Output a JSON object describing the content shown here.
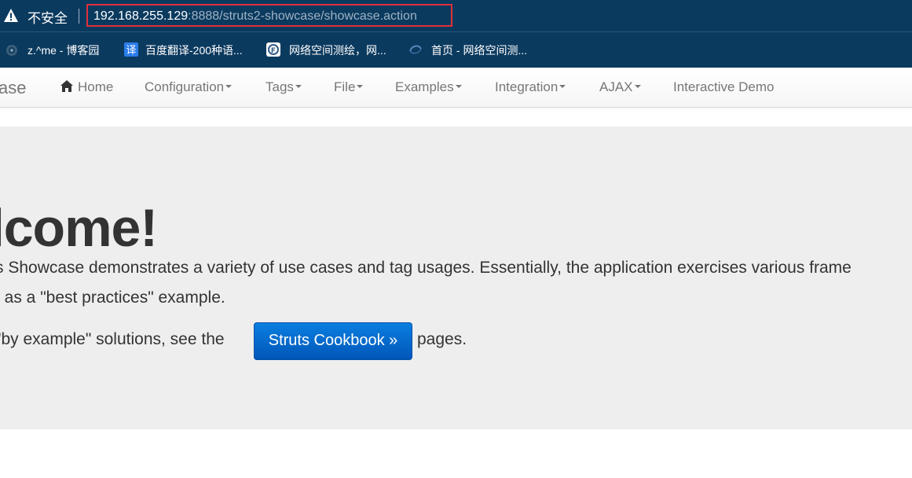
{
  "browser": {
    "security_label": "不安全",
    "url_host": "192.168.255.129",
    "url_rest": ":8888/struts2-showcase/showcase.action"
  },
  "bookmarks": [
    {
      "label": "z.^me - 博客园",
      "icon": "blog-icon"
    },
    {
      "label": "百度翻译-200种语...",
      "icon": "translate-icon"
    },
    {
      "label": "网络空间测绘，网...",
      "icon": "fofa-icon"
    },
    {
      "label": "首页 - 网络空间测...",
      "icon": "zoomeye-icon"
    }
  ],
  "navbar": {
    "brand": "ase",
    "items": [
      {
        "label": "Home",
        "icon": "home-icon"
      },
      {
        "label": "Configuration"
      },
      {
        "label": "Tags"
      },
      {
        "label": "File"
      },
      {
        "label": "Examples"
      },
      {
        "label": "Integration"
      },
      {
        "label": "AJAX"
      },
      {
        "label": "Interactive Demo"
      }
    ]
  },
  "jumbotron": {
    "heading": "elcome!",
    "line1": "s Showcase demonstrates a variety of use cases and tag usages. Essentially, the application exercises various frame",
    "line2": "t as a \"best practices\" example.",
    "line3_before": " \"by example\" solutions, see the",
    "button": "Struts Cookbook »",
    "line3_after": "pages."
  },
  "colors": {
    "browser_bar": "#0b3a5f",
    "url_highlight_border": "#e0303a",
    "jumbotron_bg": "#eeeeee",
    "button_blue": "#0066cc"
  }
}
